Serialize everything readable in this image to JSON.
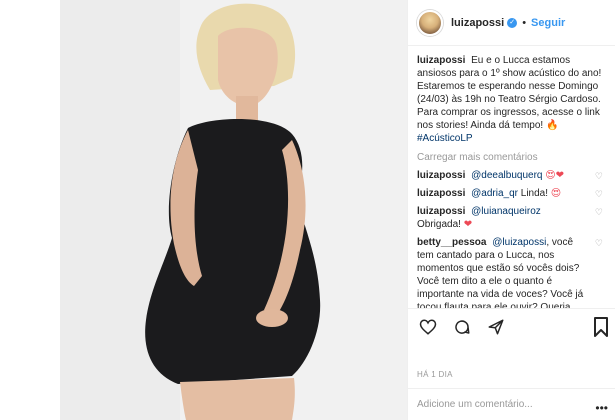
{
  "post": {
    "username": "luizapossi",
    "follow_label": "Seguir",
    "separator": "•",
    "caption_user": "luizapossi",
    "caption_text": "Eu e o Lucca estamos ansiosos para o 1º show acústico do ano! Estaremos te esperando nesse Domingo (24/03) às 19h no Teatro Sérgio Cardoso. Para comprar os ingressos, acesse o link nos stories! Ainda dá tempo! 🔥",
    "caption_hashtag": "#AcústicoLP",
    "load_more": "Carregar mais comentários",
    "comments": [
      {
        "user": "luizapossi",
        "mention": "@deealbuquerq",
        "text": "",
        "emoji": "😍❤"
      },
      {
        "user": "luizapossi",
        "mention": "@adria_qr",
        "text": "Linda!",
        "emoji": "😍"
      },
      {
        "user": "luizapossi",
        "mention": "@luianaqueiroz",
        "text": "Obrigada!",
        "emoji": "❤"
      },
      {
        "user": "betty__pessoa",
        "mention": "@luizapossi",
        "text": ", você tem cantado para o Lucca, nos momentos que estão só vocês dois? Você tem dito a ele o quanto é importante na vida de voces? Você já tocou flauta para ele ouvir? Queria muito saber como está sendo",
        "emoji": ""
      }
    ],
    "time_ago": "HÁ 1 DIA",
    "add_comment_placeholder": "Adicione um comentário...",
    "more_glyph": "•••"
  },
  "colors": {
    "link": "#3897f0",
    "mention": "#003569",
    "muted": "#999999",
    "border": "#efefef",
    "dress": "#1b1b1d",
    "background": "#f1f1f1"
  },
  "icons": {
    "verified": "verified-badge-icon",
    "like": "heart-outline-icon",
    "comment": "comment-bubble-icon",
    "share": "share-icon",
    "save": "bookmark-icon",
    "comment_like": "small-heart-icon",
    "more": "more-options-icon"
  }
}
